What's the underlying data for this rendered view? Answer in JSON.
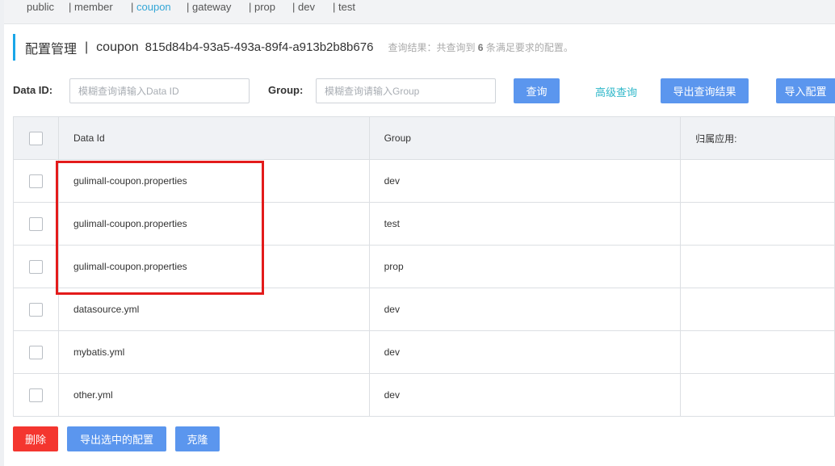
{
  "namespaces": [
    {
      "label": "public",
      "sep": ""
    },
    {
      "label": "member",
      "sep": "| "
    },
    {
      "label": "coupon",
      "sep": "| ",
      "active": true
    },
    {
      "label": "gateway",
      "sep": "| "
    },
    {
      "label": "prop",
      "sep": "| "
    },
    {
      "label": "dev",
      "sep": "| "
    },
    {
      "label": "test",
      "sep": "| "
    }
  ],
  "header": {
    "title": "配置管理",
    "separator": "|",
    "namespace": "coupon",
    "namespace_id": "815d84b4-93a5-493a-89f4-a913b2b8b676",
    "result_prefix": "查询结果：共查询到",
    "result_count": "6",
    "result_suffix": "条满足要求的配置。"
  },
  "filters": {
    "data_id_label": "Data ID:",
    "data_id_placeholder": "模糊查询请输入Data ID",
    "group_label": "Group:",
    "group_placeholder": "模糊查询请输入Group",
    "query_button": "查询",
    "advanced_query": "高级查询",
    "export_results_button": "导出查询结果",
    "import_button": "导入配置"
  },
  "table": {
    "columns": [
      "Data Id",
      "Group",
      "归属应用:"
    ],
    "rows": [
      {
        "data_id": "gulimall-coupon.properties",
        "group": "dev",
        "app": ""
      },
      {
        "data_id": "gulimall-coupon.properties",
        "group": "test",
        "app": ""
      },
      {
        "data_id": "gulimall-coupon.properties",
        "group": "prop",
        "app": ""
      },
      {
        "data_id": "datasource.yml",
        "group": "dev",
        "app": ""
      },
      {
        "data_id": "mybatis.yml",
        "group": "dev",
        "app": ""
      },
      {
        "data_id": "other.yml",
        "group": "dev",
        "app": ""
      }
    ]
  },
  "actions": {
    "delete_button": "删除",
    "export_selected_button": "导出选中的配置",
    "clone_button": "克隆"
  },
  "colors": {
    "accent": "#5b96ee",
    "danger": "#f4362f",
    "active_tab": "#33a6d6",
    "highlight": "#e31b1b"
  }
}
